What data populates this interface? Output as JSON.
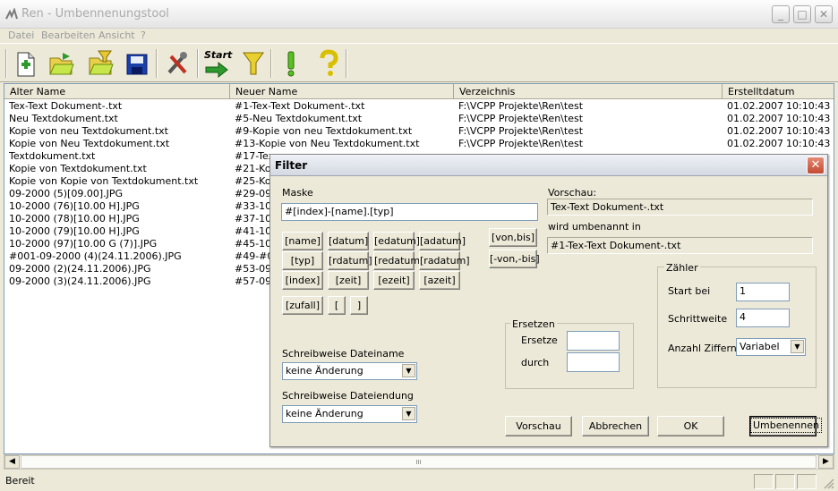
{
  "window": {
    "title": "Ren - Umbennenungstool",
    "min": "_",
    "max": "□",
    "close": "✕"
  },
  "menu": [
    {
      "label": "Datei"
    },
    {
      "label": "Bearbeiten"
    },
    {
      "label": "Ansicht"
    },
    {
      "label": "?"
    }
  ],
  "toolbar": {
    "start_label": "Start"
  },
  "columns": [
    {
      "label": "Alter Name"
    },
    {
      "label": "Neuer Name"
    },
    {
      "label": "Verzeichnis"
    },
    {
      "label": "Erstelltdatum"
    }
  ],
  "rows": [
    {
      "alt": "Tex-Text Dokument-.txt",
      "neu": "#1-Tex-Text Dokument-.txt",
      "dir": "F:\\VCPP Projekte\\Ren\\test",
      "date": "01.02.2007",
      "time": "10:10:43"
    },
    {
      "alt": "Neu Textdokument.txt",
      "neu": "#5-Neu Textdokument.txt",
      "dir": "F:\\VCPP Projekte\\Ren\\test",
      "date": "01.02.2007",
      "time": "10:10:43"
    },
    {
      "alt": "Kopie von  neu Textdokument.txt",
      "neu": "#9-Kopie von  neu Textdokument.txt",
      "dir": "F:\\VCPP Projekte\\Ren\\test",
      "date": "01.02.2007",
      "time": "10:10:43"
    },
    {
      "alt": "Kopie von Neu Textdokument.txt",
      "neu": "#13-Kopie von Neu Textdokument.txt",
      "dir": "F:\\VCPP Projekte\\Ren\\test",
      "date": "01.02.2007",
      "time": "10:10:43"
    },
    {
      "alt": "Textdokument.txt",
      "neu": "#17-Tex",
      "dir": "",
      "date": "",
      "time": ""
    },
    {
      "alt": "Kopie von Textdokument.txt",
      "neu": "#21-Kop",
      "dir": "",
      "date": "",
      "time": ""
    },
    {
      "alt": "Kopie von Kopie von Textdokument.txt",
      "neu": "#25-Kop",
      "dir": "",
      "date": "",
      "time": ""
    },
    {
      "alt": "09-2000 (5)[09.00].JPG",
      "neu": "#29-09-",
      "dir": "",
      "date": "",
      "time": ""
    },
    {
      "alt": "10-2000 (76)[10.00 H].JPG",
      "neu": "#33-10-",
      "dir": "",
      "date": "",
      "time": ""
    },
    {
      "alt": "10-2000 (78)[10.00 H].JPG",
      "neu": "#37-10-",
      "dir": "",
      "date": "",
      "time": ""
    },
    {
      "alt": "10-2000 (79)[10.00 H].JPG",
      "neu": "#41-10-",
      "dir": "",
      "date": "",
      "time": ""
    },
    {
      "alt": "10-2000 (97)[10.00 G (7)].JPG",
      "neu": "#45-10-",
      "dir": "",
      "date": "",
      "time": ""
    },
    {
      "alt": "#001-09-2000 (4)(24.11.2006).JPG",
      "neu": "#49-#0",
      "dir": "",
      "date": "",
      "time": ""
    },
    {
      "alt": "09-2000 (2)(24.11.2006).JPG",
      "neu": "#53-09-",
      "dir": "",
      "date": "",
      "time": ""
    },
    {
      "alt": "09-2000 (3)(24.11.2006).JPG",
      "neu": "#57-09-",
      "dir": "",
      "date": "",
      "time": ""
    }
  ],
  "scroll": {
    "left": "◀",
    "right": "▶",
    "thumb": "III"
  },
  "status": {
    "text": "Bereit"
  },
  "dialog": {
    "title": "Filter",
    "close": "✕",
    "maske_label": "Maske",
    "maske_value": "#[index]-[name].[typ]",
    "tokens": [
      "[name]",
      "[datum]",
      "[edatum]",
      "[adatum]",
      "[typ]",
      "[rdatum]",
      "[redatum]",
      "[radatum]",
      "[index]",
      "[zeit]",
      "[ezeit]",
      "[azeit]",
      "[zufall]",
      "[",
      "]"
    ],
    "vonbis": "[von,bis]",
    "minusvonbis": "[-von,-bis]",
    "vorschau_label": "Vorschau:",
    "vorschau_value": "Tex-Text Dokument-.txt",
    "umbenannt_label": "wird umbenannt in",
    "umbenannt_value": "#1-Tex-Text Dokument-.txt",
    "zaehler": {
      "title": "Zähler",
      "start_label": "Start bei",
      "start_value": "1",
      "step_label": "Schrittweite",
      "step_value": "4",
      "ziffern_label": "Anzahl Ziffern",
      "ziffern_value": "Variabel"
    },
    "ersetzen": {
      "title": "Ersetzen",
      "ersetze_label": "Ersetze",
      "durch_label": "durch",
      "ersetze_value": "",
      "durch_value": ""
    },
    "name_case_label": "Schreibweise Dateiname",
    "name_case_value": "keine Änderung",
    "ext_case_label": "Schreibweise Dateiendung",
    "ext_case_value": "keine Änderung",
    "buttons": {
      "vorschau": "Vorschau",
      "abbrechen": "Abbrechen",
      "ok": "OK",
      "umbenennen": "Umbenennen"
    }
  },
  "colors": {
    "accent": "#c24a30",
    "list_border": "#7f9db9"
  }
}
